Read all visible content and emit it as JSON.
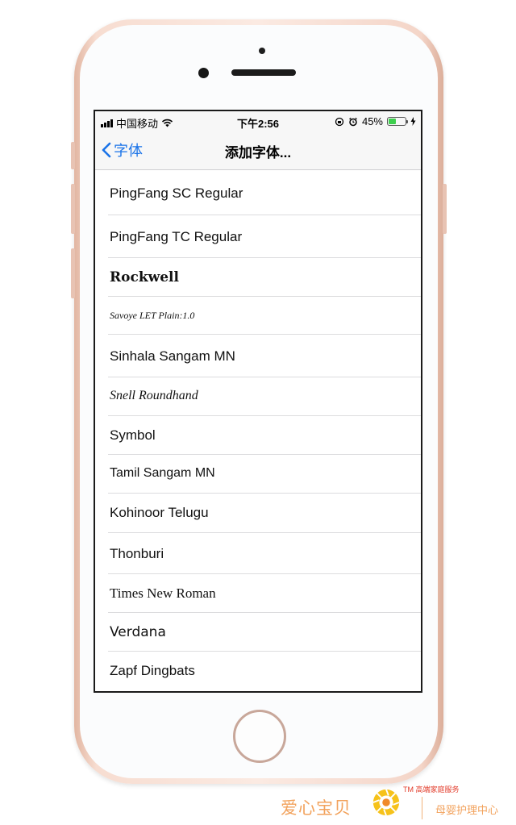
{
  "status_bar": {
    "carrier": "中国移动",
    "time": "下午2:56",
    "battery": "45%",
    "battery_level": 0.45
  },
  "nav": {
    "back_label": "字体",
    "title": "添加字体..."
  },
  "fonts": [
    "PingFang SC Regular",
    "PingFang TC Regular",
    "Rockwell",
    "Savoye LET Plain:1.0",
    "Sinhala Sangam MN",
    "Snell Roundhand",
    "Symbol",
    "Tamil Sangam MN",
    "Kohinoor Telugu",
    "Thonburi",
    "Times New Roman",
    "Verdana",
    "Zapf Dingbats"
  ],
  "watermark": {
    "brand": "爱心宝贝",
    "tm": "TM 高端家庭服务",
    "service": "母婴护理中心"
  },
  "colors": {
    "accent": "#1a73e8",
    "battery": "#3ecf4e",
    "phone_frame": "#f7ddd1"
  }
}
